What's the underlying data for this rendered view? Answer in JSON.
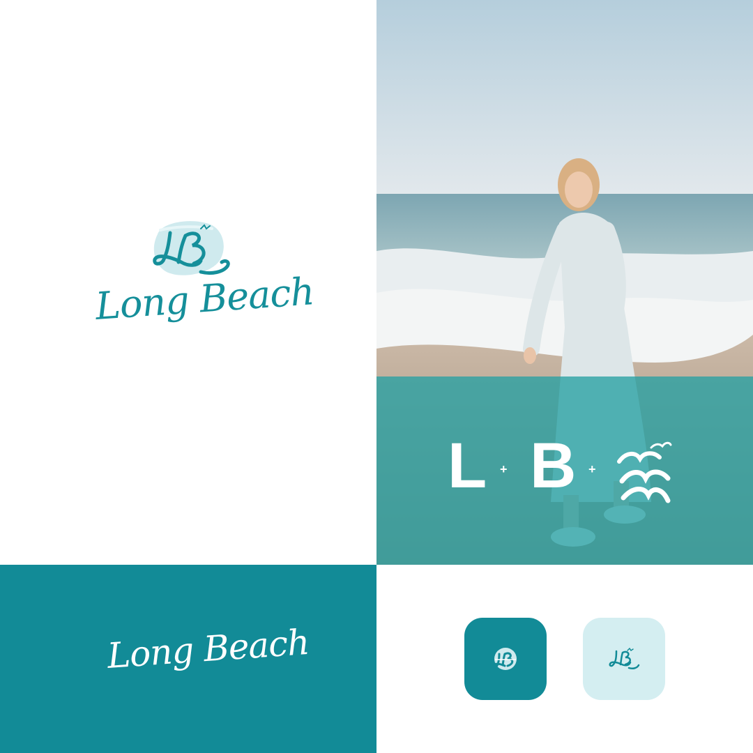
{
  "brand": {
    "name": "Long Beach",
    "monogram": {
      "first": "L",
      "separator": "+",
      "second": "B"
    },
    "logo_letter": "LB"
  },
  "icons": {
    "logo_mark": "lb-sun-wave-icon",
    "gulls": "seagulls-icon",
    "app_icon_dark": "lb-app-icon-dark",
    "app_icon_light": "lb-app-icon-light"
  },
  "colors": {
    "teal": "#128b97",
    "teal_overlay": "#26a0a3",
    "light_aqua": "#d4eef1",
    "white": "#ffffff"
  }
}
